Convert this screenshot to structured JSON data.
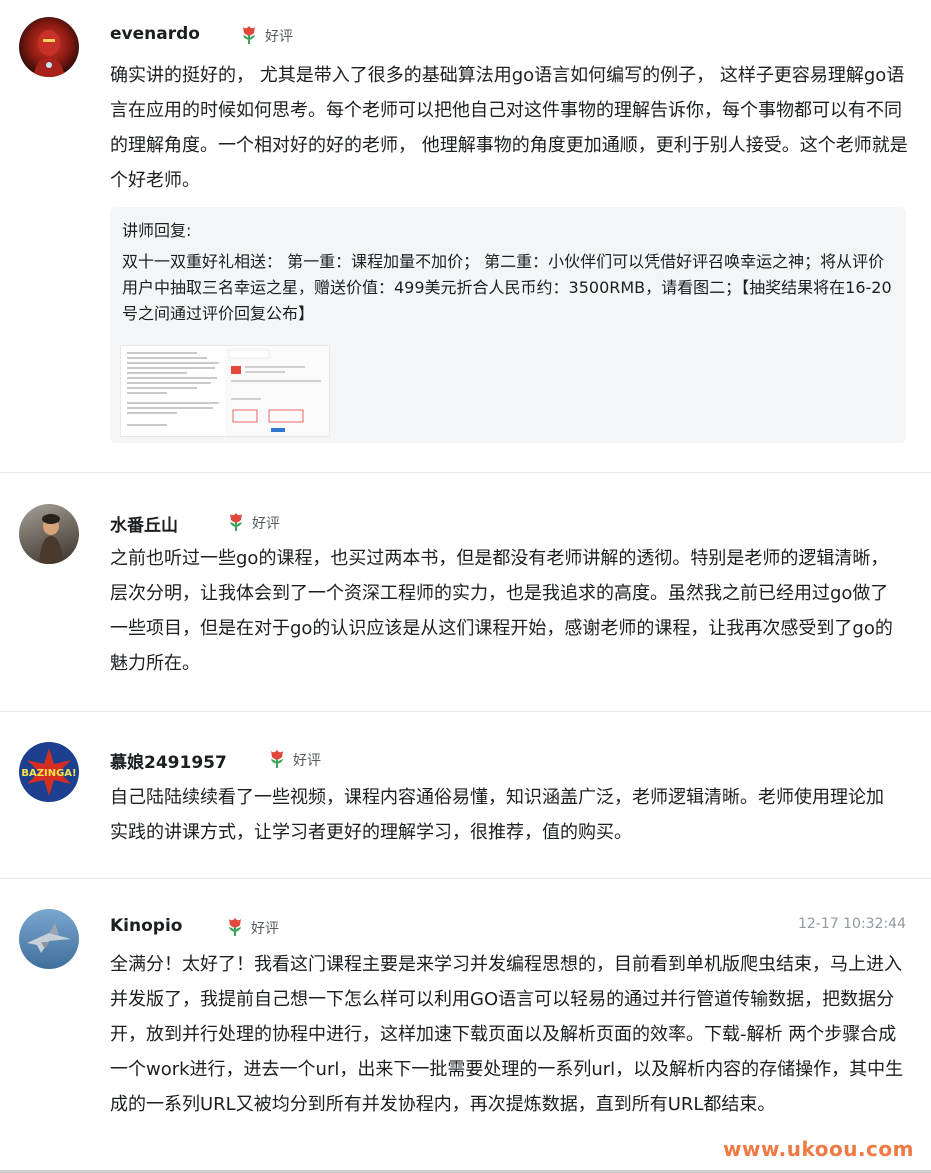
{
  "reviews": [
    {
      "username": "evenardo",
      "badge": "好评",
      "time": "",
      "content": "确实讲的挺好的， 尤其是带入了很多的基础算法用go语言如何编写的例子， 这样子更容易理解go语言在应用的时候如何思考。每个老师可以把他自己对这件事物的理解告诉你，每个事物都可以有不同的理解角度。一个相对好的好的老师， 他理解事物的角度更加通顺，更利于别人接受。这个老师就是个好老师。",
      "reply": {
        "title": "讲师回复:",
        "text": "双十一双重好礼相送： 第一重：课程加量不加价； 第二重：小伙伴们可以凭借好评召唤幸运之神；将从评价用户中抽取三名幸运之星，赠送价值：499美元折合人民币约：3500RMB，请看图二；【抽奖结果将在16-20号之间通过评价回复公布】"
      }
    },
    {
      "username": "水番丘山",
      "badge": "好评",
      "time": "",
      "content": "之前也听过一些go的课程，也买过两本书，但是都没有老师讲解的透彻。特别是老师的逻辑清晰，层次分明，让我体会到了一个资深工程师的实力，也是我追求的高度。虽然我之前已经用过go做了一些项目，但是在对于go的认识应该是从这们课程开始，感谢老师的课程，让我再次感受到了go的魅力所在。"
    },
    {
      "username": "慕娘2491957",
      "badge": "好评",
      "time": "",
      "content": "自己陆陆续续看了一些视频，课程内容通俗易懂，知识涵盖广泛，老师逻辑清晰。老师使用理论加实践的讲课方式，让学习者更好的理解学习，很推荐，值的购买。"
    },
    {
      "username": "Kinopio",
      "badge": "好评",
      "time": "12-17 10:32:44",
      "content": "全满分！太好了！我看这门课程主要是来学习并发编程思想的，目前看到单机版爬虫结束，马上进入并发版了，我提前自己想一下怎么样可以利用GO语言可以轻易的通过并行管道传输数据，把数据分开，放到并行处理的协程中进行，这样加速下载页面以及解析页面的效率。下载-解析 两个步骤合成一个work进行，进去一个url，出来下一批需要处理的一系列url，以及解析内容的存储操作，其中生成的一系列URL又被均分到所有并发协程内，再次提炼数据，直到所有URL都结束。"
    }
  ],
  "watermark": "www.ukoou.com",
  "colors": {
    "badge_flower": "#e2483d",
    "badge_leaf": "#3aa35c",
    "watermark": "#f07a43"
  }
}
